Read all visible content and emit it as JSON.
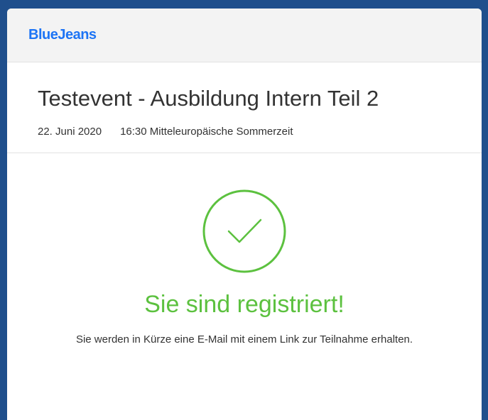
{
  "header": {
    "logo_text": "BlueJeans"
  },
  "event": {
    "title": "Testevent - Ausbildung Intern Teil 2",
    "date": "22. Juni 2020",
    "time": "16:30 Mitteleuropäische Sommerzeit"
  },
  "confirmation": {
    "icon": "check-circle-icon",
    "title": "Sie sind registriert!",
    "message": "Sie werden in Kürze eine E-Mail mit einem Link zur Teilnahme erhalten."
  },
  "colors": {
    "brand": "#1d74f5",
    "success": "#5cc13f",
    "background": "#1f4f8c"
  }
}
